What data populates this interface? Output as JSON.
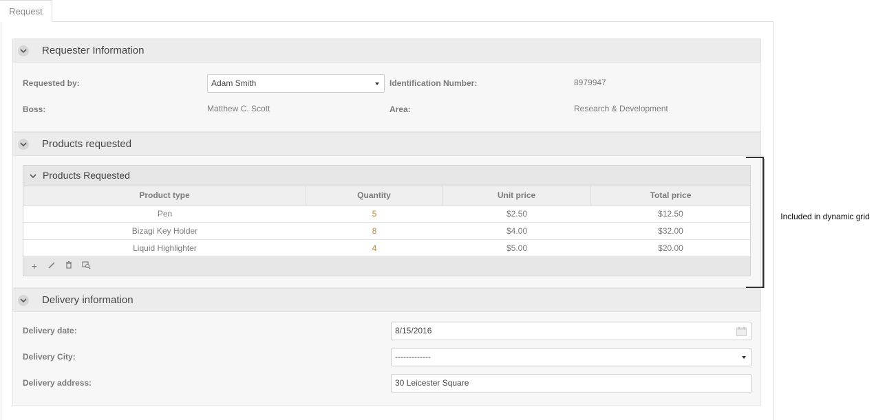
{
  "tab": {
    "label": "Request"
  },
  "requester_section": {
    "title": "Requester Information",
    "requested_by_label": "Requested by:",
    "requested_by_value": "Adam Smith",
    "id_label": "Identification Number:",
    "id_value": "8979947",
    "boss_label": "Boss:",
    "boss_value": "Matthew C. Scott",
    "area_label": "Area:",
    "area_value": "Research & Development"
  },
  "products_section": {
    "title": "Products requested",
    "grid": {
      "title": "Products Requested",
      "columns": [
        "Product type",
        "Quantity",
        "Unit price",
        "Total price"
      ],
      "rows": [
        [
          "Pen",
          "5",
          "$2.50",
          "$12.50"
        ],
        [
          "Bizagi Key Holder",
          "8",
          "$4.00",
          "$32.00"
        ],
        [
          "Liquid Highlighter",
          "4",
          "$5.00",
          "$20.00"
        ]
      ],
      "toolbar": {
        "add": "+",
        "edit": "✎",
        "delete": "🗑",
        "detail": "⌕"
      }
    }
  },
  "delivery_section": {
    "title": "Delivery information",
    "date_label": "Delivery date:",
    "date_value": "8/15/2016",
    "city_label": "Delivery City:",
    "city_value": "-------------",
    "address_label": "Delivery address:",
    "address_value": "30 Leicester Square"
  },
  "annotation": {
    "text": "Included in dynamic grid"
  }
}
